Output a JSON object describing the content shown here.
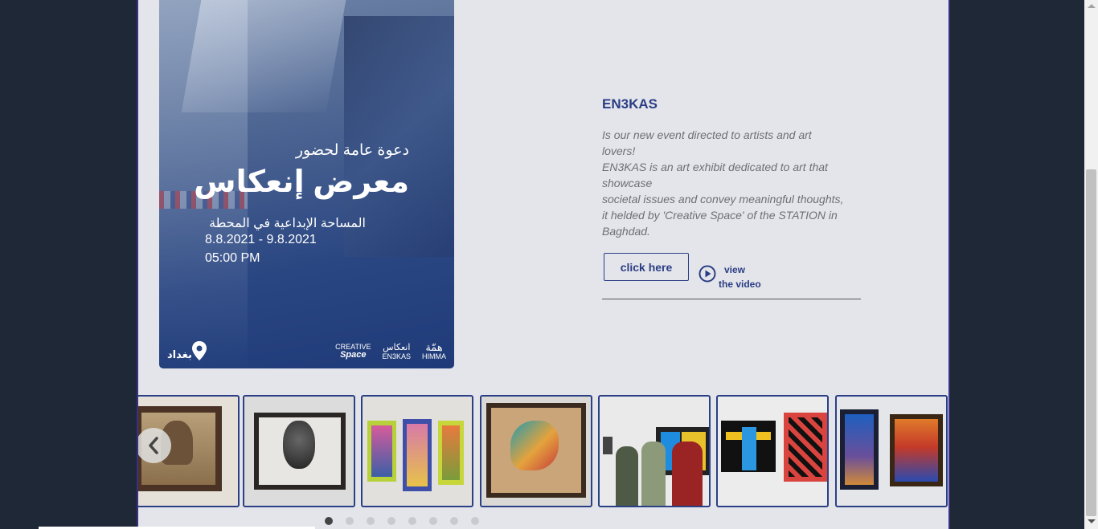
{
  "poster": {
    "invite_text": "دعوة عامة لحضور",
    "title": "معرض إنعكاس",
    "venue": "المساحة الإبداعية في المحطة",
    "dates": "8.8.2021 - 9.8.2021",
    "time": "05:00 PM",
    "city": "بغداد",
    "logos": [
      {
        "top": "CREATIVE",
        "bottom": "Space"
      },
      {
        "top": "انعكاس",
        "bottom": "EN3KAS"
      },
      {
        "top": "همّة",
        "bottom": "HIMMA"
      }
    ]
  },
  "event": {
    "title": "EN3KAS",
    "description_lines": [
      "Is our new event directed to artists and art",
      "lovers!",
      "EN3KAS is an art exhibit dedicated to art that",
      "showcase",
      "societal issues and convey meaningful thoughts,",
      "it helded by 'Creative Space' of the STATION in",
      "Baghdad."
    ],
    "click_label": "click here",
    "video_line1": "view",
    "video_line2": "the video"
  },
  "carousel": {
    "thumbnails": [
      {
        "subject": "framed sepia portrait painting"
      },
      {
        "subject": "framed charcoal portrait of a man"
      },
      {
        "subject": "three colorful framed face paintings"
      },
      {
        "subject": "framed painting of a reclining figure"
      },
      {
        "subject": "visitors viewing artworks"
      },
      {
        "subject": "geometric colorful calligraphy paintings"
      },
      {
        "subject": "framed paintings of mosques"
      }
    ],
    "dots_count": 8,
    "active_dot": 0
  },
  "colors": {
    "accent": "#2a3d85",
    "panel_bg": "#e4e5ea",
    "page_bg": "#1f2836",
    "body_text": "#6d6f78"
  }
}
